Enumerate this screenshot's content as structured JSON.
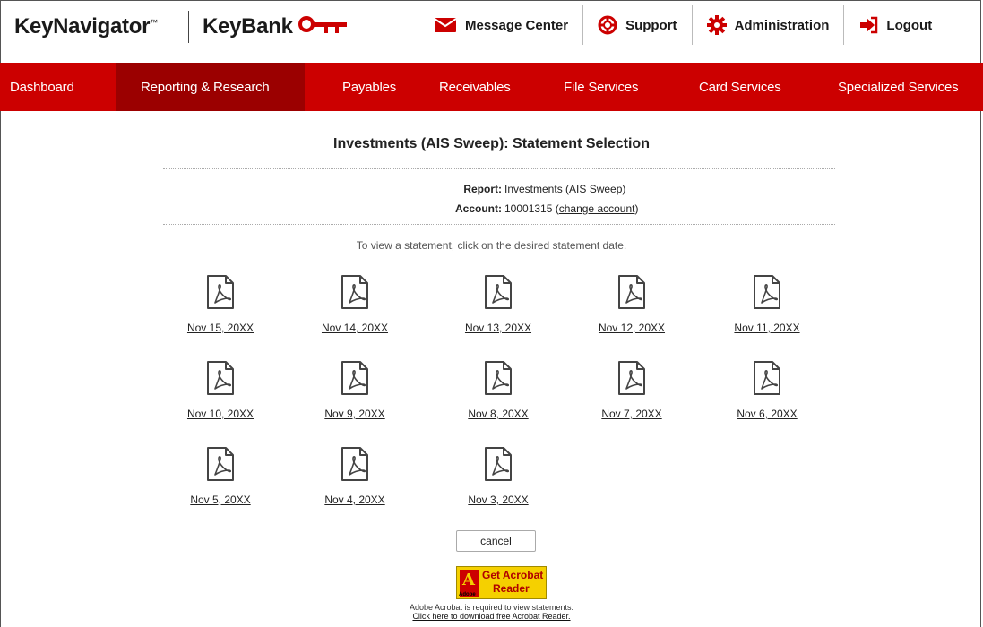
{
  "header": {
    "brand_keynavigator": "KeyNavigator",
    "brand_tm": "™",
    "brand_keybank": "KeyBank",
    "links": [
      {
        "label": "Message Center",
        "icon": "envelope-icon"
      },
      {
        "label": "Support",
        "icon": "lifebuoy-icon"
      },
      {
        "label": "Administration",
        "icon": "gear-icon"
      },
      {
        "label": "Logout",
        "icon": "logout-icon"
      }
    ],
    "accent": "#cc0000"
  },
  "nav": {
    "items": [
      {
        "label": "Dashboard",
        "active": false
      },
      {
        "label": "Reporting & Research",
        "active": true
      },
      {
        "label": "Payables",
        "active": false
      },
      {
        "label": "Receivables",
        "active": false
      },
      {
        "label": "File Services",
        "active": false
      },
      {
        "label": "Card Services",
        "active": false
      },
      {
        "label": "Specialized Services",
        "active": false
      }
    ],
    "bg_color": "#cc0000",
    "active_color": "#9b0000"
  },
  "page": {
    "title": "Investments (AIS Sweep): Statement Selection",
    "report_label": "Report:",
    "report_value": "Investments (AIS Sweep)",
    "account_label": "Account:",
    "account_value": "10001315",
    "change_account_label": "change account",
    "instruction": "To view a statement, click on the desired statement date."
  },
  "statements": [
    {
      "date": "Nov 15, 20XX",
      "icon": "pdf-icon"
    },
    {
      "date": "Nov 14, 20XX",
      "icon": "pdf-icon"
    },
    {
      "date": "Nov 13, 20XX",
      "icon": "pdf-icon"
    },
    {
      "date": "Nov 12, 20XX",
      "icon": "pdf-icon"
    },
    {
      "date": "Nov 11, 20XX",
      "icon": "pdf-icon"
    },
    {
      "date": "Nov 10, 20XX",
      "icon": "pdf-icon"
    },
    {
      "date": "Nov 9, 20XX",
      "icon": "pdf-icon"
    },
    {
      "date": "Nov 8, 20XX",
      "icon": "pdf-icon"
    },
    {
      "date": "Nov 7, 20XX",
      "icon": "pdf-icon"
    },
    {
      "date": "Nov 6, 20XX",
      "icon": "pdf-icon"
    },
    {
      "date": "Nov 5, 20XX",
      "icon": "pdf-icon"
    },
    {
      "date": "Nov 4, 20XX",
      "icon": "pdf-icon"
    },
    {
      "date": "Nov 3, 20XX",
      "icon": "pdf-icon"
    }
  ],
  "actions": {
    "cancel_label": "cancel"
  },
  "acrobat": {
    "badge_line1": "Get Acrobat",
    "badge_line2": "Reader",
    "badge_logo": "A",
    "badge_adobe": "Adobe",
    "note": "Adobe Acrobat is required to view statements.",
    "download_link": "Click here to download free Acrobat Reader."
  }
}
